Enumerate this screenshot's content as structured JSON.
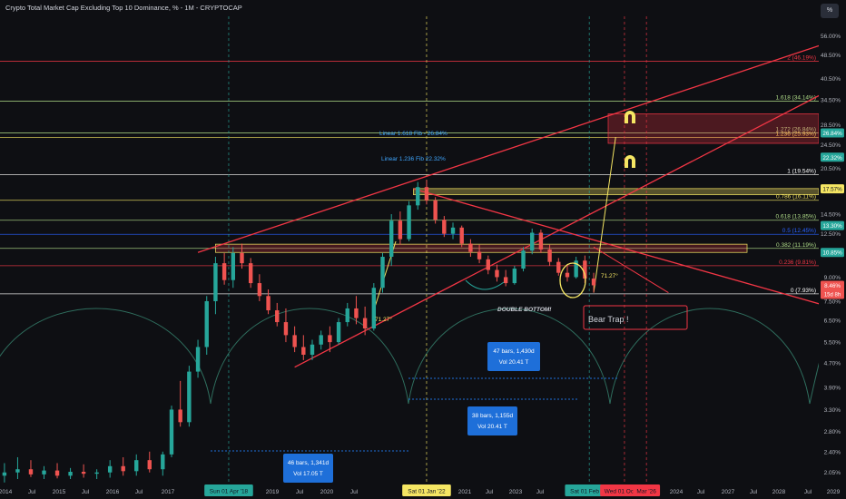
{
  "header": {
    "title": "Crypto Total Market Cap Excluding Top 10 Dominance, % - 1M - CRYPTOCAP",
    "unit_button": "%"
  },
  "colors": {
    "background": "#0e0f13",
    "up": "#26a69a",
    "down": "#ef5350",
    "trendline": "#f23645",
    "fib": "#b2df8a",
    "yellow": "#f5e663",
    "cycle": "#2f6e5e"
  },
  "chart_data": {
    "type": "candlestick",
    "title": "Crypto Total Market Cap Excluding Top 10 Dominance, %",
    "interval": "1M",
    "source": "CRYPTOCAP",
    "y_scale": "log",
    "ylim": [
      1.95,
      64
    ],
    "price_axis_labels": [
      "56.00%",
      "48.50%",
      "40.50%",
      "34.50%",
      "28.50%",
      "24.50%",
      "20.50%",
      "17.50%",
      "14.50%",
      "12.50%",
      "11.00%",
      "9.00%",
      "7.50%",
      "6.50%",
      "5.50%",
      "4.70%",
      "3.90%",
      "3.30%",
      "2.80%",
      "2.40%",
      "2.05%"
    ],
    "time_axis_labels": [
      "2014",
      "Jul",
      "2015",
      "Jul",
      "2016",
      "Jul",
      "2017",
      "Jul",
      "2019",
      "Jul",
      "2020",
      "Jul",
      "2021",
      "Jul",
      "2023",
      "Jul",
      "2024",
      "Jul",
      "2027",
      "Jul",
      "2028",
      "Jul",
      "2029",
      "Jul"
    ],
    "date_markers": [
      {
        "label": "Sun 01 Apr '18",
        "date": "2018-04-01",
        "color": "#26a69a"
      },
      {
        "label": "Sat 01 Jan '22",
        "date": "2022-01-01",
        "color": "#f5e663"
      },
      {
        "label": "Sat 01 Feb '25",
        "date": "2025-02-01",
        "color": "#26a69a"
      },
      {
        "label": "Wed 01 Oct '25",
        "date": "2025-10-01",
        "color": "#f23645"
      },
      {
        "label": "Mar '26",
        "date": "2026-03-01",
        "color": "#f23645"
      }
    ],
    "price_tags": [
      {
        "label": "26.84%",
        "value": 26.84,
        "color": "#26a69a"
      },
      {
        "label": "22.32%",
        "value": 22.32,
        "color": "#26a69a"
      },
      {
        "label": "17.57%",
        "value": 17.57,
        "color": "#f5e663"
      },
      {
        "label": "13.30%",
        "value": 13.3,
        "color": "#26a69a"
      },
      {
        "label": "10.85%",
        "value": 10.85,
        "color": "#26a69a"
      },
      {
        "label": "8.46%",
        "value": 8.46,
        "color": "#ef5350",
        "sub": "15d 8h"
      }
    ],
    "fib_levels": [
      {
        "label": "2 (46.19%)",
        "value": 46.19,
        "color": "#f23645"
      },
      {
        "label": "1.618 (34.14%)",
        "value": 34.14,
        "color": "#b2df8a"
      },
      {
        "label": "1.272 (26.84%)",
        "value": 26.84,
        "color": "#b2df8a"
      },
      {
        "label": "1.236 (25.93%)",
        "value": 25.93,
        "color": "#f5e663"
      },
      {
        "label": "1 (19.54%)",
        "value": 19.54,
        "color": "#ffffff"
      },
      {
        "label": "0.786 (16.11%)",
        "value": 16.11,
        "color": "#f5e663"
      },
      {
        "label": "0.618 (13.85%)",
        "value": 13.85,
        "color": "#b2df8a"
      },
      {
        "label": "0.5 (12.45%)",
        "value": 12.45,
        "color": "#2962ff"
      },
      {
        "label": "0.382 (11.19%)",
        "value": 11.19,
        "color": "#b2df8a"
      },
      {
        "label": "0.236 (9.81%)",
        "value": 9.81,
        "color": "#f23645"
      },
      {
        "label": "0 (7.93%)",
        "value": 7.93,
        "color": "#ffffff"
      }
    ],
    "annotations": {
      "linear_fib_1618": "Linear 1.618 Fib - 26.84%",
      "linear_fib_1236": "Linear 1.236 Fib 22.32%",
      "angle_1": "71.27°",
      "angle_2": "71.27°",
      "double_bottom": "DOUBLE BOTTOM!",
      "bear_trap": "Bear Trap !",
      "range_47": [
        "47 bars, 1,430d",
        "Vol 20.41 T"
      ],
      "range_38": [
        "38 bars, 1,155d",
        "Vol 20.41 T"
      ],
      "range_46": [
        "46 bars, 1,341d",
        "Vol 17.05 T"
      ]
    },
    "candles": [
      {
        "t": "2014-01",
        "o": 2.0,
        "h": 2.2,
        "l": 1.9,
        "c": 2.05
      },
      {
        "t": "2014-04",
        "o": 2.05,
        "h": 2.3,
        "l": 1.95,
        "c": 2.1
      },
      {
        "t": "2014-07",
        "o": 2.1,
        "h": 2.25,
        "l": 1.98,
        "c": 2.02
      },
      {
        "t": "2014-10",
        "o": 2.02,
        "h": 2.15,
        "l": 1.95,
        "c": 2.08
      },
      {
        "t": "2015-01",
        "o": 2.08,
        "h": 2.2,
        "l": 1.96,
        "c": 2.0
      },
      {
        "t": "2015-04",
        "o": 2.0,
        "h": 2.12,
        "l": 1.95,
        "c": 2.06
      },
      {
        "t": "2015-07",
        "o": 2.06,
        "h": 2.18,
        "l": 1.97,
        "c": 2.03
      },
      {
        "t": "2015-10",
        "o": 2.03,
        "h": 2.1,
        "l": 1.95,
        "c": 2.05
      },
      {
        "t": "2016-01",
        "o": 2.05,
        "h": 2.25,
        "l": 1.97,
        "c": 2.15
      },
      {
        "t": "2016-04",
        "o": 2.15,
        "h": 2.3,
        "l": 2.0,
        "c": 2.07
      },
      {
        "t": "2016-07",
        "o": 2.07,
        "h": 2.35,
        "l": 2.0,
        "c": 2.25
      },
      {
        "t": "2016-10",
        "o": 2.25,
        "h": 2.4,
        "l": 2.05,
        "c": 2.1
      },
      {
        "t": "2017-01",
        "o": 2.1,
        "h": 2.4,
        "l": 2.0,
        "c": 2.35
      },
      {
        "t": "2017-03",
        "o": 2.35,
        "h": 3.4,
        "l": 2.3,
        "c": 3.3
      },
      {
        "t": "2017-05",
        "o": 3.3,
        "h": 4.1,
        "l": 2.9,
        "c": 3.0
      },
      {
        "t": "2017-07",
        "o": 3.0,
        "h": 4.6,
        "l": 2.9,
        "c": 4.4
      },
      {
        "t": "2017-09",
        "o": 4.4,
        "h": 5.6,
        "l": 4.2,
        "c": 5.3
      },
      {
        "t": "2017-11",
        "o": 5.3,
        "h": 7.8,
        "l": 5.0,
        "c": 7.5
      },
      {
        "t": "2018-01",
        "o": 7.5,
        "h": 10.5,
        "l": 6.8,
        "c": 10.0
      },
      {
        "t": "2018-03",
        "o": 10.0,
        "h": 10.8,
        "l": 8.5,
        "c": 8.8
      },
      {
        "t": "2018-05",
        "o": 8.8,
        "h": 11.3,
        "l": 8.3,
        "c": 10.8
      },
      {
        "t": "2018-07",
        "o": 10.8,
        "h": 11.6,
        "l": 9.6,
        "c": 10.0
      },
      {
        "t": "2018-09",
        "o": 10.0,
        "h": 10.4,
        "l": 8.3,
        "c": 8.6
      },
      {
        "t": "2018-11",
        "o": 8.6,
        "h": 9.2,
        "l": 7.5,
        "c": 7.8
      },
      {
        "t": "2019-01",
        "o": 7.8,
        "h": 8.2,
        "l": 6.8,
        "c": 7.0
      },
      {
        "t": "2019-03",
        "o": 7.0,
        "h": 7.4,
        "l": 6.2,
        "c": 6.4
      },
      {
        "t": "2019-05",
        "o": 6.4,
        "h": 7.1,
        "l": 5.5,
        "c": 5.8
      },
      {
        "t": "2019-07",
        "o": 5.8,
        "h": 6.2,
        "l": 5.1,
        "c": 5.3
      },
      {
        "t": "2019-09",
        "o": 5.3,
        "h": 5.8,
        "l": 4.8,
        "c": 5.0
      },
      {
        "t": "2019-11",
        "o": 5.0,
        "h": 5.6,
        "l": 4.8,
        "c": 5.4
      },
      {
        "t": "2020-01",
        "o": 5.4,
        "h": 6.0,
        "l": 5.2,
        "c": 5.8
      },
      {
        "t": "2020-03",
        "o": 5.8,
        "h": 6.2,
        "l": 5.1,
        "c": 5.5
      },
      {
        "t": "2020-05",
        "o": 5.5,
        "h": 6.6,
        "l": 5.4,
        "c": 6.4
      },
      {
        "t": "2020-07",
        "o": 6.4,
        "h": 7.4,
        "l": 6.2,
        "c": 7.1
      },
      {
        "t": "2020-09",
        "o": 7.1,
        "h": 7.8,
        "l": 6.3,
        "c": 6.6
      },
      {
        "t": "2020-11",
        "o": 6.6,
        "h": 7.2,
        "l": 5.8,
        "c": 6.1
      },
      {
        "t": "2021-01",
        "o": 6.1,
        "h": 8.6,
        "l": 6.0,
        "c": 8.3
      },
      {
        "t": "2021-03",
        "o": 8.3,
        "h": 10.8,
        "l": 8.0,
        "c": 10.5
      },
      {
        "t": "2021-05",
        "o": 10.5,
        "h": 14.5,
        "l": 9.8,
        "c": 13.8
      },
      {
        "t": "2021-07",
        "o": 13.8,
        "h": 14.8,
        "l": 11.5,
        "c": 12.0
      },
      {
        "t": "2021-09",
        "o": 12.0,
        "h": 16.0,
        "l": 11.8,
        "c": 15.5
      },
      {
        "t": "2021-11",
        "o": 15.5,
        "h": 18.5,
        "l": 15.0,
        "c": 17.8
      },
      {
        "t": "2022-01",
        "o": 17.8,
        "h": 18.8,
        "l": 15.6,
        "c": 16.1
      },
      {
        "t": "2022-03",
        "o": 16.1,
        "h": 16.5,
        "l": 13.5,
        "c": 13.9
      },
      {
        "t": "2022-05",
        "o": 13.9,
        "h": 14.3,
        "l": 12.2,
        "c": 12.5
      },
      {
        "t": "2022-07",
        "o": 12.5,
        "h": 13.6,
        "l": 12.0,
        "c": 13.1
      },
      {
        "t": "2022-09",
        "o": 13.1,
        "h": 13.3,
        "l": 11.3,
        "c": 11.6
      },
      {
        "t": "2022-11",
        "o": 11.6,
        "h": 12.0,
        "l": 10.5,
        "c": 10.9
      },
      {
        "t": "2023-01",
        "o": 10.9,
        "h": 11.5,
        "l": 10.0,
        "c": 10.3
      },
      {
        "t": "2023-03",
        "o": 10.3,
        "h": 10.6,
        "l": 9.2,
        "c": 9.5
      },
      {
        "t": "2023-05",
        "o": 9.5,
        "h": 9.9,
        "l": 8.7,
        "c": 9.0
      },
      {
        "t": "2023-07",
        "o": 9.0,
        "h": 9.5,
        "l": 8.4,
        "c": 8.6
      },
      {
        "t": "2023-09",
        "o": 8.6,
        "h": 9.8,
        "l": 8.5,
        "c": 9.6
      },
      {
        "t": "2023-11",
        "o": 9.6,
        "h": 11.3,
        "l": 9.4,
        "c": 11.0
      },
      {
        "t": "2024-01",
        "o": 11.0,
        "h": 13.0,
        "l": 10.7,
        "c": 12.6
      },
      {
        "t": "2024-03",
        "o": 12.6,
        "h": 12.9,
        "l": 10.8,
        "c": 11.1
      },
      {
        "t": "2024-05",
        "o": 11.1,
        "h": 11.5,
        "l": 9.8,
        "c": 10.1
      },
      {
        "t": "2024-07",
        "o": 10.1,
        "h": 10.4,
        "l": 9.1,
        "c": 9.3
      },
      {
        "t": "2024-09",
        "o": 9.3,
        "h": 9.8,
        "l": 8.7,
        "c": 9.0
      },
      {
        "t": "2024-11",
        "o": 9.0,
        "h": 10.5,
        "l": 8.9,
        "c": 10.2
      },
      {
        "t": "2025-01",
        "o": 10.2,
        "h": 10.6,
        "l": 8.6,
        "c": 8.9
      },
      {
        "t": "2025-03",
        "o": 8.9,
        "h": 9.3,
        "l": 8.0,
        "c": 8.46
      }
    ]
  }
}
